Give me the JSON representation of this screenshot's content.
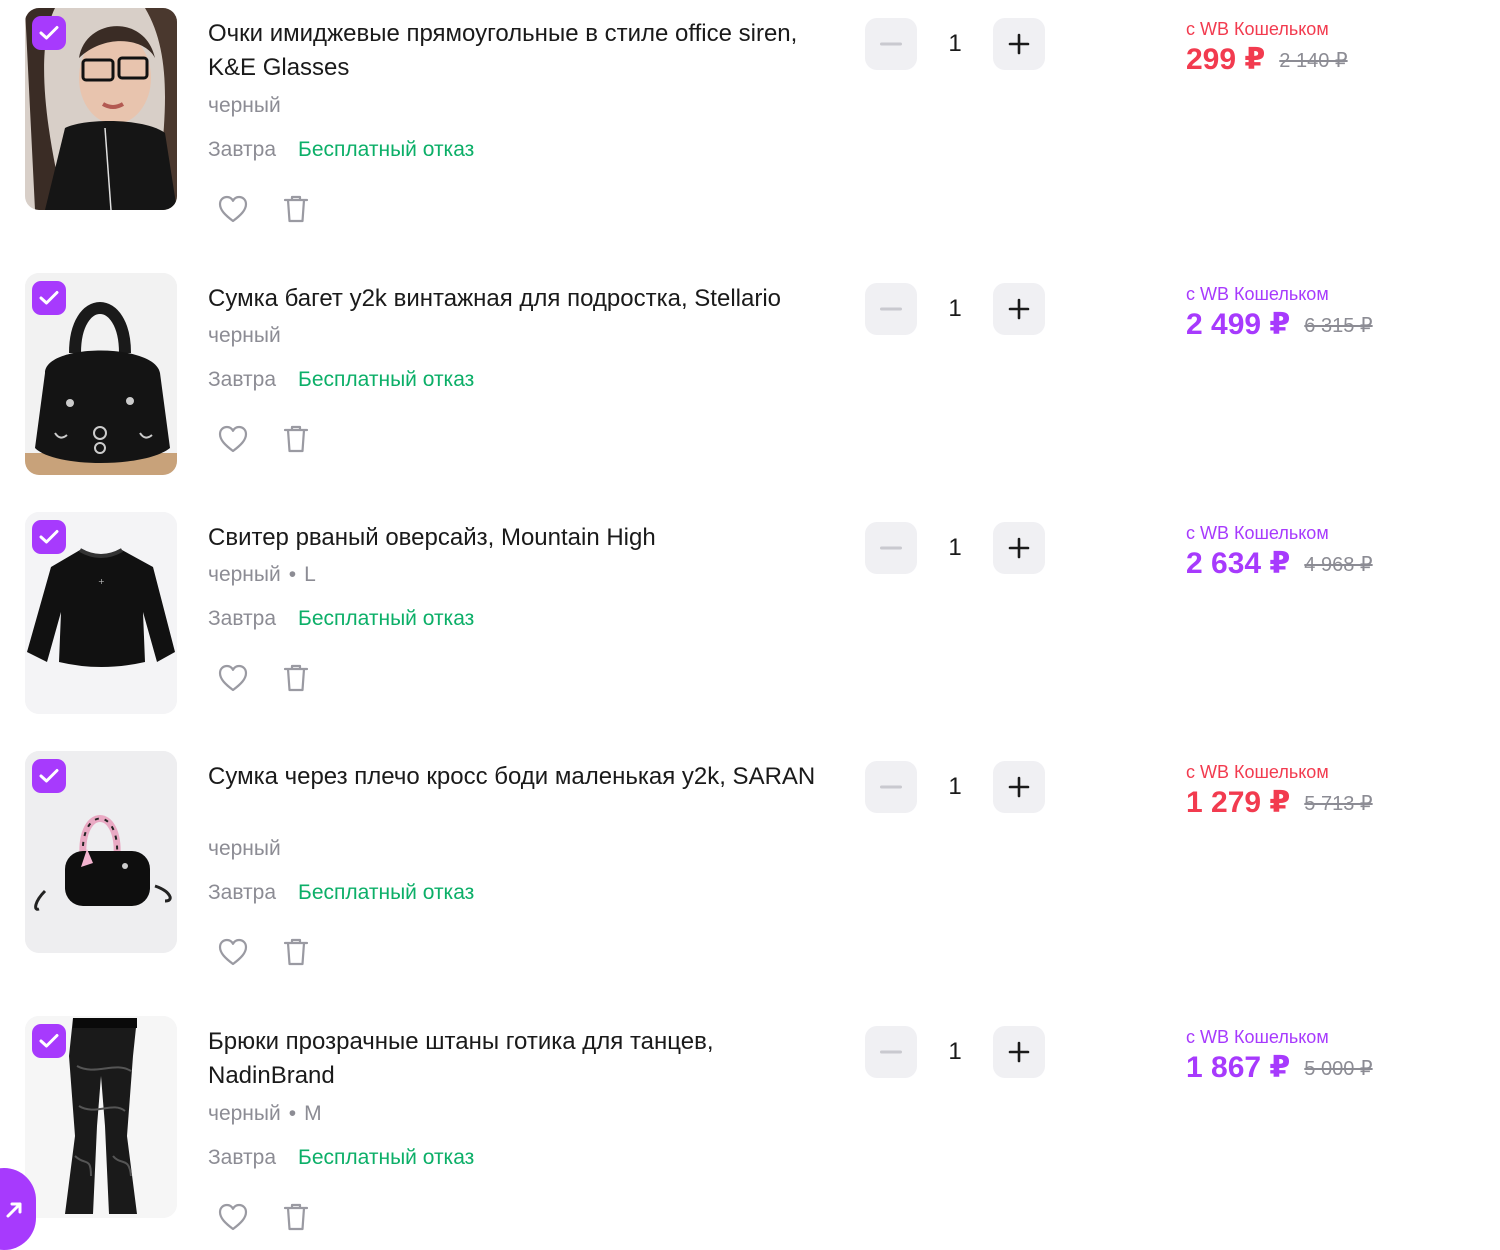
{
  "cart": {
    "items": [
      {
        "title": "Очки имиджевые прямоугольные в стиле office siren, K&E Glasses",
        "color": "черный",
        "size": "",
        "delivery": "Завтра",
        "return_policy": "Бесплатный отказ",
        "quantity": "1",
        "wallet_label": "с WB Кошельком",
        "price": "299 ₽",
        "old_price": "2 140 ₽",
        "price_color": "#f23b4f",
        "image": "woman-in-glasses-photo"
      },
      {
        "title": "Сумка багет y2k винтажная для подростка, Stellario",
        "color": "черный",
        "size": "",
        "delivery": "Завтра",
        "return_policy": "Бесплатный отказ",
        "quantity": "1",
        "wallet_label": "с WB Кошельком",
        "price": "2 499 ₽",
        "old_price": "6 315 ₽",
        "price_color": "#a73afd",
        "image": "black-baguette-bag-photo"
      },
      {
        "title": "Свитер рваный оверсайз, Mountain High",
        "color": "черный",
        "size": "L",
        "delivery": "Завтра",
        "return_policy": "Бесплатный отказ",
        "quantity": "1",
        "wallet_label": "с WB Кошельком",
        "price": "2 634 ₽",
        "old_price": "4 968 ₽",
        "price_color": "#a73afd",
        "image": "black-sweater-photo"
      },
      {
        "title": "Сумка через плечо кросс боди маленькая y2k, SARAN",
        "color": "черный",
        "size": "",
        "delivery": "Завтра",
        "return_policy": "Бесплатный отказ",
        "quantity": "1",
        "wallet_label": "с WB Кошельком",
        "price": "1 279 ₽",
        "old_price": "5 713 ₽",
        "price_color": "#f23b4f",
        "image": "crossbody-bag-photo"
      },
      {
        "title": "Брюки прозрачные штаны готика для танцев, NadinBrand",
        "color": "черный",
        "size": "M",
        "delivery": "Завтра",
        "return_policy": "Бесплатный отказ",
        "quantity": "1",
        "wallet_label": "с WB Кошельком",
        "price": "1 867 ₽",
        "old_price": "5 000 ₽",
        "price_color": "#a73afd",
        "image": "lace-flared-pants-photo"
      }
    ]
  },
  "colors": {
    "accent": "#a73afd",
    "free_return": "#0caf68",
    "price_red": "#f23b4f"
  }
}
